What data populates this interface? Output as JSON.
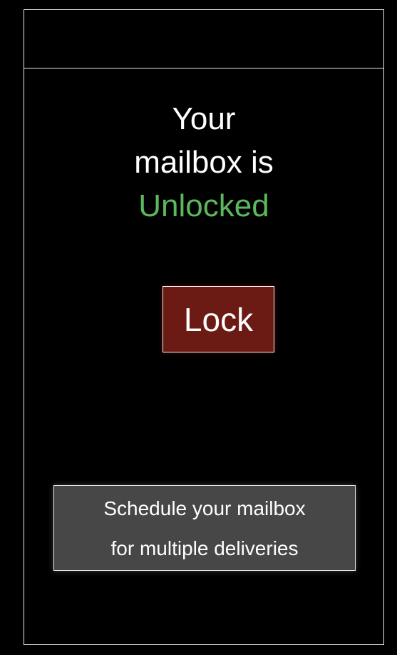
{
  "status": {
    "line1": "Your",
    "line2": "mailbox is",
    "state": "Unlocked",
    "state_color": "#5cb85c"
  },
  "lock_button": {
    "label": "Lock",
    "color": "#6b1b14"
  },
  "schedule_button": {
    "line1": "Schedule your mailbox",
    "line2": "for multiple deliveries"
  }
}
